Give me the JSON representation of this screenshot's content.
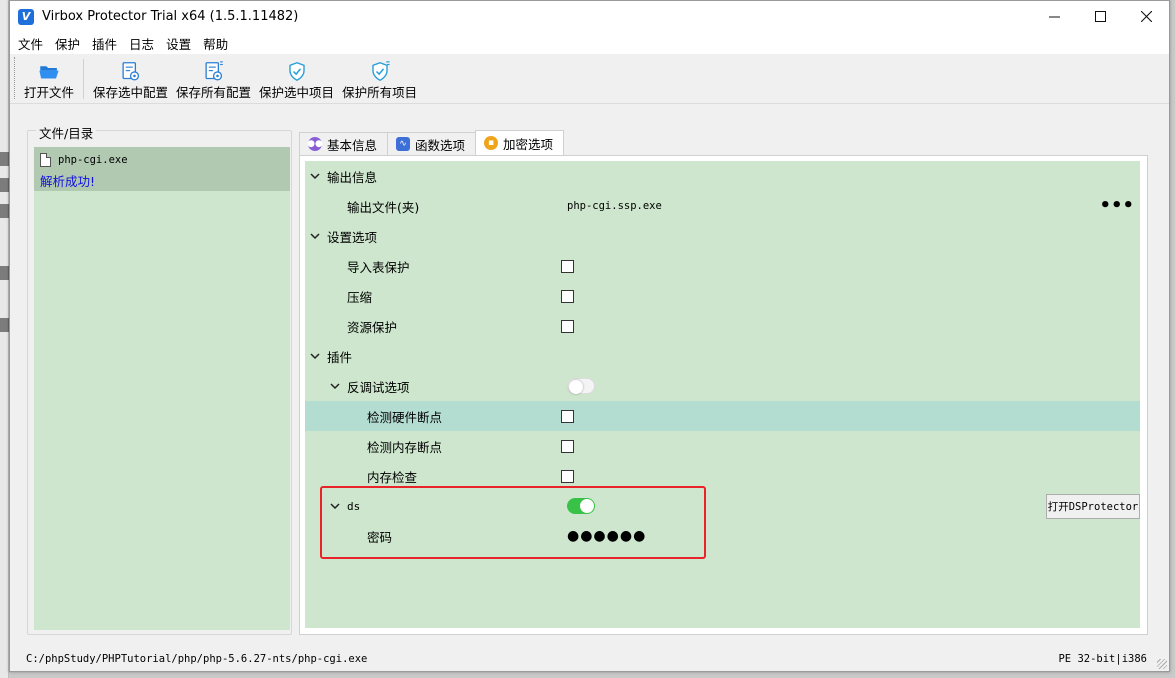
{
  "window": {
    "app_icon_letter": "V",
    "title": "Virbox Protector Trial x64  (1.5.1.11482)"
  },
  "menu": [
    "文件",
    "保护",
    "插件",
    "日志",
    "设置",
    "帮助"
  ],
  "toolbar": {
    "open_file": "打开文件",
    "save_selected_config": "保存选中配置",
    "save_all_config": "保存所有配置",
    "protect_selected": "保护选中项目",
    "protect_all": "保护所有项目"
  },
  "file_panel": {
    "title": "文件/目录",
    "file_name": "php-cgi.exe",
    "status": "解析成功!"
  },
  "tabs": [
    "基本信息",
    "函数选项",
    "加密选项"
  ],
  "active_tab": "加密选项",
  "props": {
    "output_section": "输出信息",
    "output_file_label": "输出文件(夹)",
    "output_file_value": "php-cgi.ssp.exe",
    "settings_section": "设置选项",
    "import_protect": "导入表保护",
    "compress": "压缩",
    "resource_protect": "资源保护",
    "plugins_section": "插件",
    "anti_debug": "反调试选项",
    "hw_breakpoint": "检测硬件断点",
    "mem_breakpoint": "检测内存断点",
    "mem_check": "内存检查",
    "ds_section": "ds",
    "password_label": "密码",
    "password_value": "●●●●●●",
    "ds_button": "打开DSProtector"
  },
  "status": {
    "path": "C:/phpStudy/PHPTutorial/php/php-5.6.27-nts/php-cgi.exe",
    "arch": "PE 32-bit|i386"
  },
  "colors": {
    "panel_green": "#cde6cd",
    "selected_row": "#b1c8b1",
    "highlight_row": "#b4ddd2",
    "toggle_on": "#38c248",
    "annotation_red": "#e8242a"
  }
}
